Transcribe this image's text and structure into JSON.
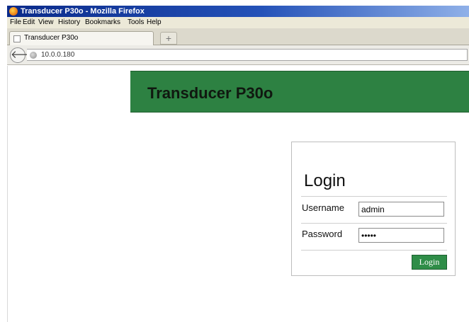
{
  "window": {
    "title": "Transducer P30o - Mozilla Firefox"
  },
  "menu": {
    "items": [
      "File",
      "Edit",
      "View",
      "History",
      "Bookmarks",
      "Tools",
      "Help"
    ]
  },
  "tabs": [
    {
      "label": "Transducer P30o"
    }
  ],
  "newtab_symbol": "+",
  "navigation": {
    "back_symbol": "🡐",
    "url": "10.0.0.180"
  },
  "page": {
    "header_title": "Transducer P30o"
  },
  "login": {
    "title": "Login",
    "username_label": "Username",
    "username_value": "admin",
    "password_label": "Password",
    "password_value": "•••••",
    "submit_label": "Login"
  },
  "colors": {
    "header_bg": "#2d8142",
    "button_bg": "#2f8d48",
    "titlebar": "#0a2a8a"
  }
}
